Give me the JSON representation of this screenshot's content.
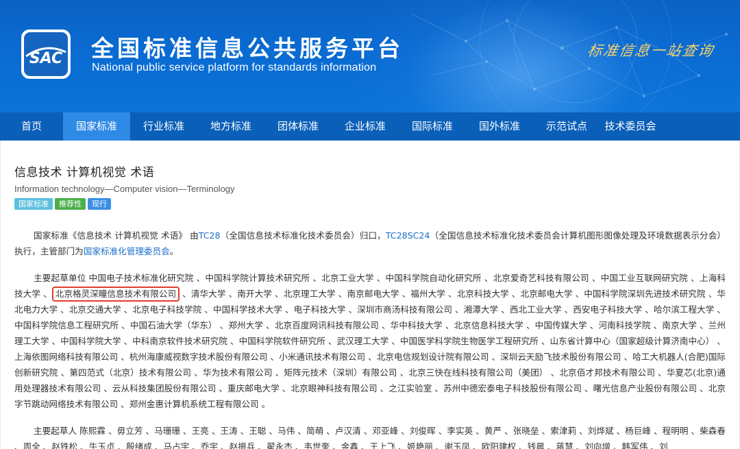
{
  "header": {
    "logo_text": "SAC",
    "title_cn": "全国标准信息公共服务平台",
    "title_en": "National public service platform  for standards information",
    "slogan": "标准信息一站查询"
  },
  "nav": [
    "首页",
    "国家标准",
    "行业标准",
    "地方标准",
    "团体标准",
    "企业标准",
    "国际标准",
    "国外标准",
    "示范试点",
    "技术委员会"
  ],
  "nav_active_index": 1,
  "standard": {
    "title": "信息技术 计算机视觉 术语",
    "title_en": "Information technology—Computer vision—Terminology",
    "tags": [
      "国家标准",
      "推荐性",
      "现行"
    ]
  },
  "para1": {
    "pre": "国家标准《信息技术 计算机视觉 术语》 由",
    "tc_link": "TC28",
    "mid": "（全国信息技术标准化技术委员会）归口，",
    "sc_link": "SC24",
    "sc_prefix": "TC28",
    "post": "（全国信息技术标准化技术委员会计算机图形图像处理及环境数据表示分会）执行，主管部门为",
    "dept_link": "国家标准化管理委员会",
    "end": "。"
  },
  "para2": {
    "label": "主要起草单位 ",
    "before_highlight": "中国电子技术标准化研究院 、中国科学院计算技术研究所 、北京工业大学 、中国科学院自动化研究所 、北京爱奇艺科技有限公司 、中国工业互联网研究院 、上海科技大学 、",
    "highlight": "北京格灵深瞳信息技术有限公司",
    "after_highlight": " 、清华大学 、南开大学 、北京理工大学 、南京邮电大学 、福州大学 、北京科技大学 、北京邮电大学 、中国科学院深圳先进技术研究院 、华北电力大学 、北京交通大学 、北京电子科技学院 、中国科学技术大学 、电子科技大学 、深圳市商汤科技有限公司 、湘潭大学 、西北工业大学 、西安电子科技大学 、哈尔滨工程大学 、中国科学院信息工程研究所 、中国石油大学（华东） 、郑州大学 、北京百度网讯科技有限公司 、华中科技大学 、北京信息科技大学 、中国传媒大学 、河南科技学院 、南京大学 、兰州理工大学 、中国科学院大学 、中科南京软件技术研究院 、中国科学院软件研究所 、武汉理工大学 、中国医学科学院生物医学工程研究所 、山东省计算中心（国家超级计算济南中心） 、上海依图网络科技有限公司 、杭州海康威视数字技术股份有限公司 、小米通讯技术有限公司 、北京电信规划设计院有限公司 、深圳云天励飞技术股份有限公司 、哈工大机器人(合肥)国际创新研究院 、第四范式（北京）技术有限公司 、华为技术有限公司 、矩阵元技术（深圳）有限公司 、北京三快在线科技有限公司（美团） 、北京佰才邦技术有限公司 、华夏芯(北京)通用处理器技术有限公司 、云从科技集团股份有限公司 、重庆邮电大学 、北京眼神科技有限公司 、之江实验室 、苏州中德宏泰电子科技股份有限公司 、曙光信息产业股份有限公司 、北京字节跳动网络技术有限公司 、郑州金惠计算机系统工程有限公司 。"
  },
  "para3": {
    "label": "主要起草人 ",
    "text": "陈熙霖 、毋立芳 、马珊珊 、王亮 、王涛 、王聪 、马伟 、简萌 、卢汉清 、邓亚峰 、刘俊晖 、李实英 、黄严 、张晓垒 、索津莉 、刘烨斌 、杨巨峰 、程明明 、柴森春 、周全 、赵铁松 、牛玉贞 、殷绪成 、马占宇 、乔宇 、赵振兵 、翟永杰 、韦世奎 、金鑫 、王上飞 、姬艳丽 、谢玉凤 、欧阳建权 、钱晨 、蒋慧 、刘向增 、韩军伟 、刘"
  }
}
